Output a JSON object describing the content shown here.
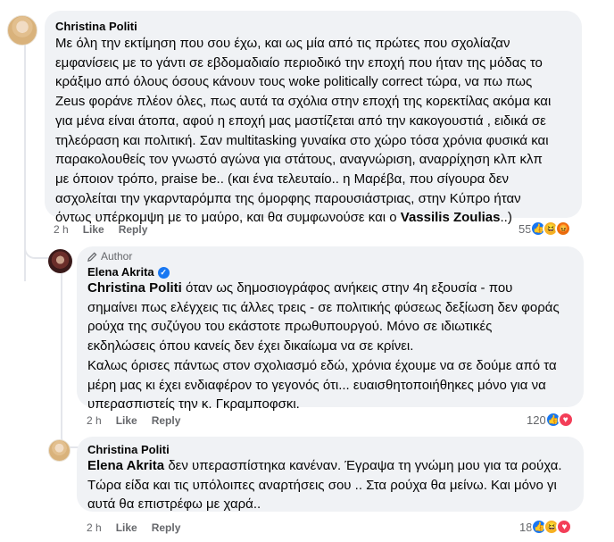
{
  "comments": [
    {
      "author": "Christina Politi",
      "lines": [
        "Με όλη την εκτίμηση που σου έχω, και ως μία από τις πρώτες που σχολίαζαν",
        "εμφανίσεις με το γάντι σε εβδομαδιαίο περιοδικό την εποχή που ήταν της μόδας το",
        "κράξιμο από όλους όσους κάνουν τους woke politically correct τώρα, να πω πως",
        "Zeus φοράνε πλέον όλες, πως αυτά τα σχόλια στην εποχή της κορεκτίλας ακόμα και",
        "για μένα είναι άτοπα, αφού η εποχή μας μαστίζεται από την κακογουστιά , ειδικά σε",
        "τηλεόραση και πολιτική. Σαν multitasking γυναίκα στο χώρο τόσα χρόνια φυσικά και",
        "παρακολουθείς τον γνωστό αγώνα για στάτους, αναγνώριση, αναρρίχηση κλπ κλπ",
        "με όποιον τρόπο, praise be.. (και ένα τελευταίο.. η Μαρέβα, που σίγουρα δεν",
        "ασχολείται την γκαρνταρόμπα της όμορφης παρουσιάστριας, στην Κύπρο ήταν"
      ],
      "last_line_prefix": "όντως υπέρκομψη με το μαύρο, και θα συμφωνούσε και ο ",
      "last_line_mention": "Vassilis Zoulias",
      "last_line_suffix": "..)",
      "time": "2 h",
      "like": "Like",
      "reply": "Reply",
      "reaction_count": "55",
      "reactions": [
        "like",
        "haha",
        "angry"
      ]
    },
    {
      "badge": "Author",
      "author": "Elena Akrita",
      "verified": true,
      "mention": "Christina Politi",
      "first_line_rest": " όταν ως δημοσιογράφος ανήκεις στην 4η εξουσία - που",
      "lines": [
        "σημαίνει πως ελέγχεις τις άλλες τρεις - σε πολιτικής φύσεως δεξίωση δεν φοράς",
        "ρούχα της συζύγου του εκάστοτε πρωθυπουργού. Μόνο σε ιδιωτικές",
        "εκδηλώσεις όπου κανείς δεν έχει δικαίωμα να σε κρίνει.",
        "Καλως όρισες πάντως στον σχολιασμό εδώ, χρόνια έχουμε να σε δούμε από τα",
        "μέρη μας κι έχει ενδιαφέρον το γεγονός ότι... ευαισθητοποιήθηκες μόνο για να",
        "υπερασπιστείς την κ. Γκραμποφσκι."
      ],
      "time": "2 h",
      "like": "Like",
      "reply": "Reply",
      "reaction_count": "120",
      "reactions": [
        "like",
        "love"
      ]
    },
    {
      "author": "Christina Politi",
      "mention": "Elena Akrita",
      "first_line_rest": " δεν υπερασπίστηκα κανέναν. Έγραψα τη γνώμη μου για τα ρούχα.",
      "lines": [
        "Τώρα είδα και τις υπόλοιπες αναρτήσεις σου .. Στα ρούχα θα μείνω. Και μόνο γι",
        "αυτά θα επιστρέφω με χαρά.."
      ],
      "time": "2 h",
      "like": "Like",
      "reply": "Reply",
      "reaction_count": "18",
      "reactions": [
        "like",
        "haha",
        "love"
      ]
    }
  ],
  "icons": {
    "like": "like-reaction-icon",
    "haha": "haha-reaction-icon",
    "angry": "angry-reaction-icon",
    "love": "love-reaction-icon",
    "pencil": "pencil-icon",
    "verified": "verified-badge-icon"
  },
  "colors": {
    "bubble": "#f0f2f5",
    "link": "#050505",
    "meta": "#65676b",
    "like_blue": "#1877f2"
  }
}
